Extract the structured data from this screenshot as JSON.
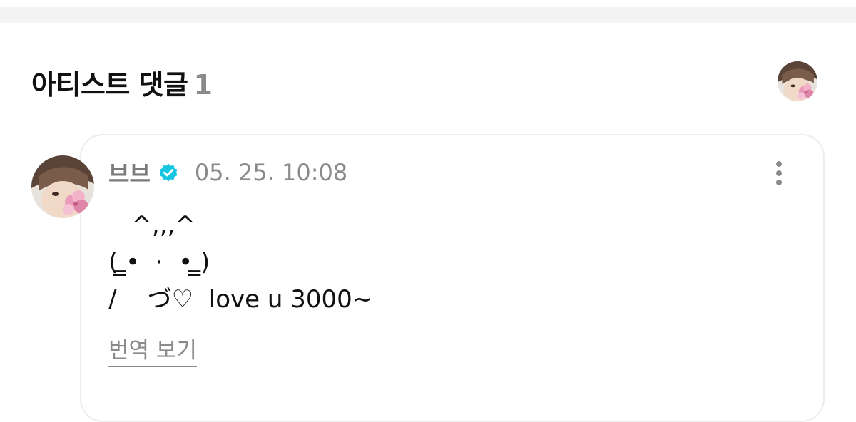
{
  "section": {
    "title": "아티스트 댓글",
    "count": "1"
  },
  "comment": {
    "author": "브브",
    "verified_icon": "verified-check-icon",
    "timestamp": "05. 25. 10:08",
    "body_lines": [
      "   ^,,,^",
      "( ̳•  ·  • ̳)",
      "/    づ♡  love u 3000~"
    ],
    "translate_label": "번역 보기",
    "more_icon": "more-vertical-icon"
  },
  "colors": {
    "verified": "#16c5e0",
    "muted_text": "#8a8a8a",
    "card_border": "#ececec"
  }
}
